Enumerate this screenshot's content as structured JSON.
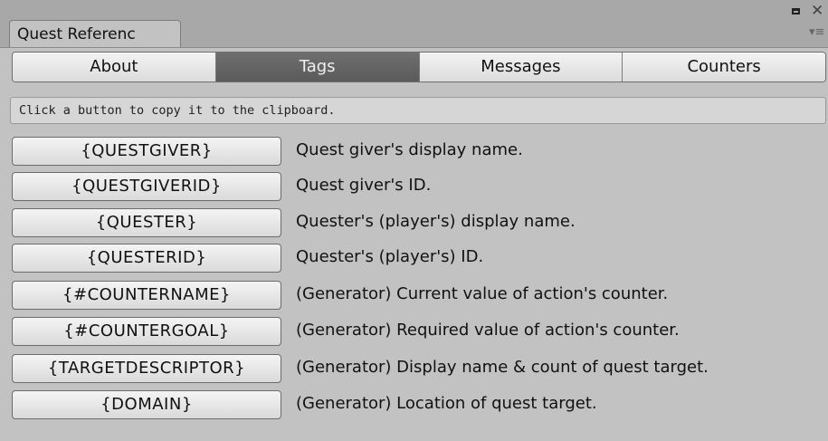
{
  "window": {
    "tab_title": "Quest Referenc",
    "maximize_icon": "maximize-icon",
    "close_icon": "close-icon",
    "menu_icon": "menu-icon"
  },
  "toolbar": {
    "tabs": [
      {
        "label": "About"
      },
      {
        "label": "Tags"
      },
      {
        "label": "Messages"
      },
      {
        "label": "Counters"
      }
    ],
    "selected": "Tags"
  },
  "hint": "Click a button to copy it to the clipboard.",
  "tags": [
    {
      "tag": "{QUESTGIVER}",
      "description": "Quest giver's display name."
    },
    {
      "tag": "{QUESTGIVERID}",
      "description": "Quest giver's ID."
    },
    {
      "tag": "{QUESTER}",
      "description": "Quester's (player's) display name."
    },
    {
      "tag": "{QUESTERID}",
      "description": "Quester's (player's) ID."
    },
    {
      "tag": "{#COUNTERNAME}",
      "description": "(Generator) Current value of action's counter."
    },
    {
      "tag": "{#COUNTERGOAL}",
      "description": "(Generator) Required value of action's counter."
    },
    {
      "tag": "{TARGETDESCRIPTOR}",
      "description": "(Generator) Display name & count of quest target."
    },
    {
      "tag": "{DOMAIN}",
      "description": "(Generator) Location of quest target."
    }
  ],
  "colors": {
    "background": "#c2c2c2",
    "selected_tab": "#5f5f5f",
    "button": "#e8e8e8"
  }
}
